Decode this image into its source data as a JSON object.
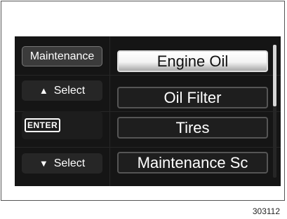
{
  "left_buttons": {
    "maintenance": "Maintenance",
    "up_icon": "triangle-up-icon",
    "up_select": "Select",
    "enter": "ENTER",
    "down_icon": "triangle-down-icon",
    "down_select": "Select"
  },
  "menu": {
    "selected_index": 0,
    "items": [
      "Engine Oil",
      "Oil Filter",
      "Tires",
      "Maintenance Sc"
    ]
  },
  "figure_code": "303112",
  "colors": {
    "screen_background": "#151515",
    "selected_item": "#ffffff",
    "button_text": "#ffffff"
  }
}
